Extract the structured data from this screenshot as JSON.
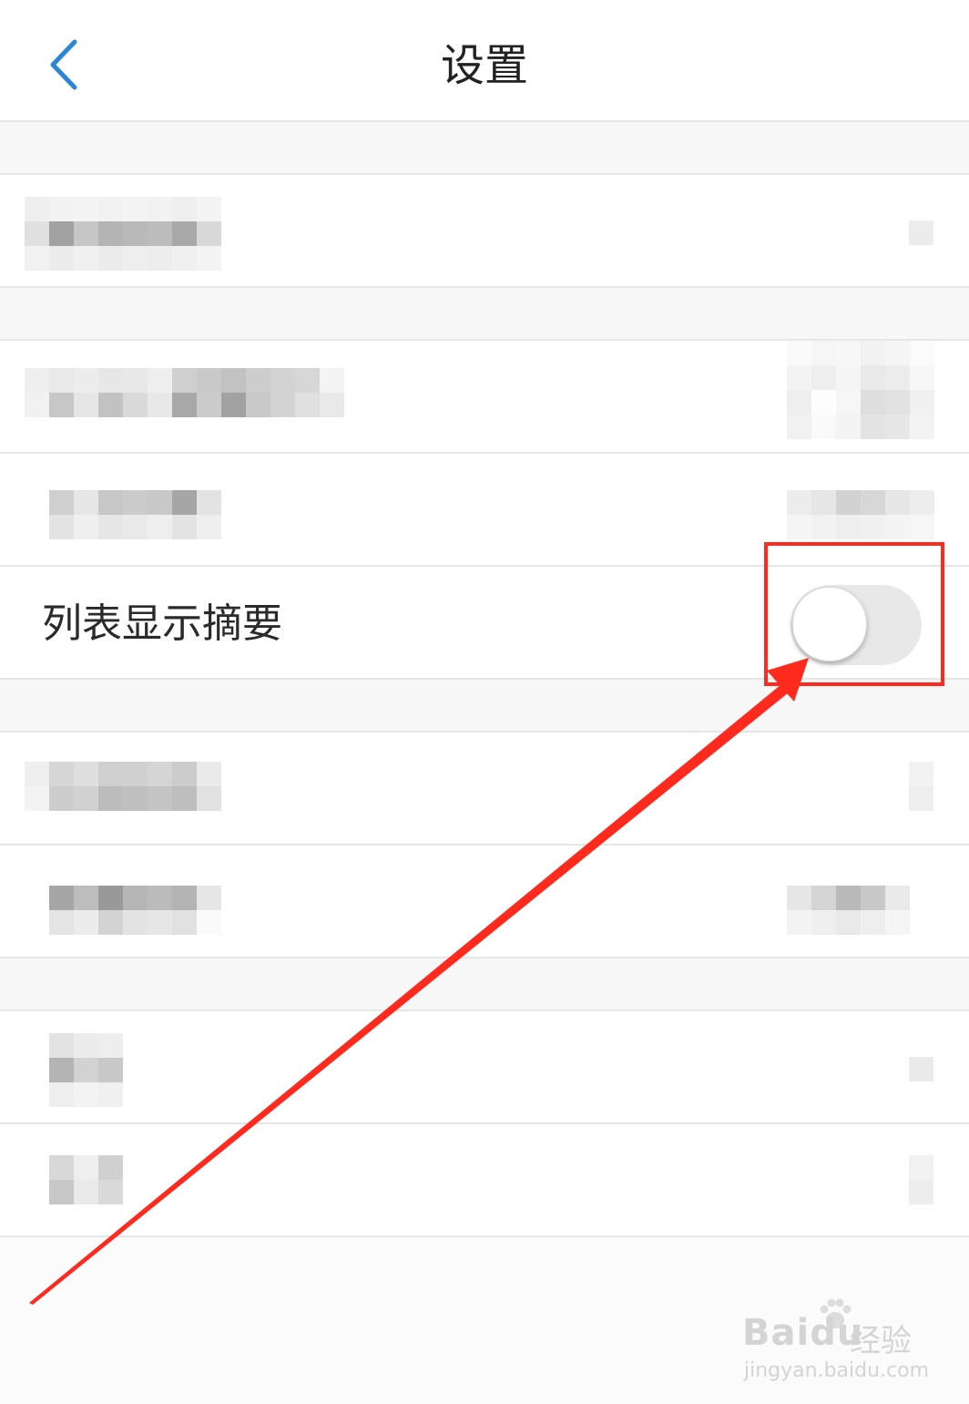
{
  "header": {
    "title": "设置",
    "back_icon": "chevron-left-icon"
  },
  "settings": {
    "list_summary": {
      "label": "列表显示摘要",
      "toggle_on": false
    }
  },
  "colors": {
    "accent_blue": "#2b86d8",
    "annotation_red": "#ff2a1e",
    "toggle_track_off": "#e8e8e8"
  },
  "watermark": {
    "logo": "Bai",
    "logo2": "du",
    "cn": "经验",
    "url": "jingyan.baidu.com"
  }
}
